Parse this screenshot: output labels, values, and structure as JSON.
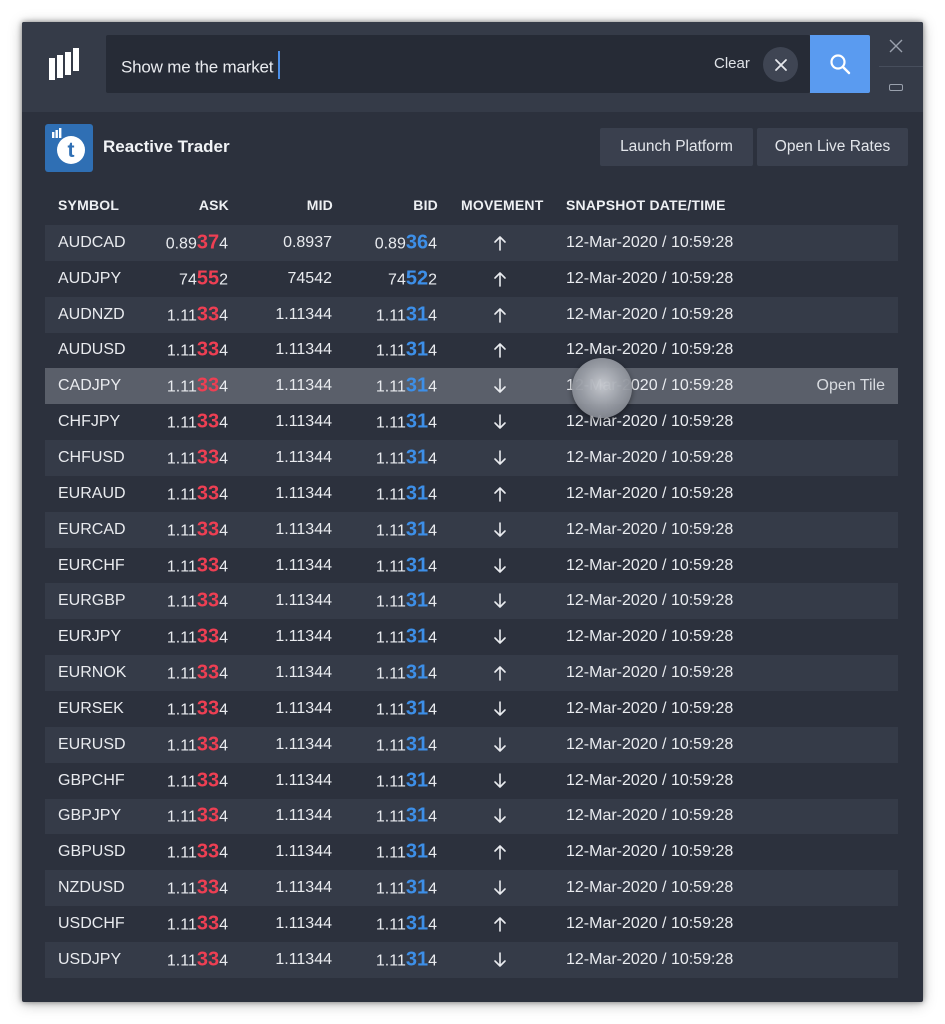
{
  "search": {
    "query": "Show me the market",
    "clear_label": "Clear",
    "search_icon": "search-icon",
    "clear_icon": "close-icon"
  },
  "window_controls": {
    "close_icon": "close-icon",
    "minimize_icon": "minimize-icon"
  },
  "app": {
    "name": "Reactive Trader",
    "icon": "t",
    "launch_label": "Launch Platform",
    "live_rates_label": "Open Live Rates"
  },
  "table": {
    "columns": [
      "SYMBOL",
      "ASK",
      "MID",
      "BID",
      "MOVEMENT",
      "SNAPSHOT DATE/TIME"
    ],
    "hover_action": "Open Tile",
    "rows": [
      {
        "symbol": "AUDCAD",
        "ask": [
          "0.89",
          "37",
          "4"
        ],
        "mid": "0.8937",
        "bid": [
          "0.89",
          "36",
          "4"
        ],
        "movement": "up",
        "datetime": "12-Mar-2020 / 10:59:28"
      },
      {
        "symbol": "AUDJPY",
        "ask": [
          "74",
          "55",
          "2"
        ],
        "mid": "74542",
        "bid": [
          "74",
          "52",
          "2"
        ],
        "movement": "up",
        "datetime": "12-Mar-2020 / 10:59:28"
      },
      {
        "symbol": "AUDNZD",
        "ask": [
          "1.11",
          "33",
          "4"
        ],
        "mid": "1.11344",
        "bid": [
          "1.11",
          "31",
          "4"
        ],
        "movement": "up",
        "datetime": "12-Mar-2020 / 10:59:28"
      },
      {
        "symbol": "AUDUSD",
        "ask": [
          "1.11",
          "33",
          "4"
        ],
        "mid": "1.11344",
        "bid": [
          "1.11",
          "31",
          "4"
        ],
        "movement": "up",
        "datetime": "12-Mar-2020 / 10:59:28"
      },
      {
        "symbol": "CADJPY",
        "ask": [
          "1.11",
          "33",
          "4"
        ],
        "mid": "1.11344",
        "bid": [
          "1.11",
          "31",
          "4"
        ],
        "movement": "down",
        "datetime": "12-Mar-2020 / 10:59:28",
        "hover": true
      },
      {
        "symbol": "CHFJPY",
        "ask": [
          "1.11",
          "33",
          "4"
        ],
        "mid": "1.11344",
        "bid": [
          "1.11",
          "31",
          "4"
        ],
        "movement": "down",
        "datetime": "12-Mar-2020 / 10:59:28"
      },
      {
        "symbol": "CHFUSD",
        "ask": [
          "1.11",
          "33",
          "4"
        ],
        "mid": "1.11344",
        "bid": [
          "1.11",
          "31",
          "4"
        ],
        "movement": "down",
        "datetime": "12-Mar-2020 / 10:59:28"
      },
      {
        "symbol": "EURAUD",
        "ask": [
          "1.11",
          "33",
          "4"
        ],
        "mid": "1.11344",
        "bid": [
          "1.11",
          "31",
          "4"
        ],
        "movement": "up",
        "datetime": "12-Mar-2020 / 10:59:28"
      },
      {
        "symbol": "EURCAD",
        "ask": [
          "1.11",
          "33",
          "4"
        ],
        "mid": "1.11344",
        "bid": [
          "1.11",
          "31",
          "4"
        ],
        "movement": "down",
        "datetime": "12-Mar-2020 / 10:59:28"
      },
      {
        "symbol": "EURCHF",
        "ask": [
          "1.11",
          "33",
          "4"
        ],
        "mid": "1.11344",
        "bid": [
          "1.11",
          "31",
          "4"
        ],
        "movement": "down",
        "datetime": "12-Mar-2020 / 10:59:28"
      },
      {
        "symbol": "EURGBP",
        "ask": [
          "1.11",
          "33",
          "4"
        ],
        "mid": "1.11344",
        "bid": [
          "1.11",
          "31",
          "4"
        ],
        "movement": "down",
        "datetime": "12-Mar-2020 / 10:59:28"
      },
      {
        "symbol": "EURJPY",
        "ask": [
          "1.11",
          "33",
          "4"
        ],
        "mid": "1.11344",
        "bid": [
          "1.11",
          "31",
          "4"
        ],
        "movement": "down",
        "datetime": "12-Mar-2020 / 10:59:28"
      },
      {
        "symbol": "EURNOK",
        "ask": [
          "1.11",
          "33",
          "4"
        ],
        "mid": "1.11344",
        "bid": [
          "1.11",
          "31",
          "4"
        ],
        "movement": "up",
        "datetime": "12-Mar-2020 / 10:59:28"
      },
      {
        "symbol": "EURSEK",
        "ask": [
          "1.11",
          "33",
          "4"
        ],
        "mid": "1.11344",
        "bid": [
          "1.11",
          "31",
          "4"
        ],
        "movement": "down",
        "datetime": "12-Mar-2020 / 10:59:28"
      },
      {
        "symbol": "EURUSD",
        "ask": [
          "1.11",
          "33",
          "4"
        ],
        "mid": "1.11344",
        "bid": [
          "1.11",
          "31",
          "4"
        ],
        "movement": "down",
        "datetime": "12-Mar-2020 / 10:59:28"
      },
      {
        "symbol": "GBPCHF",
        "ask": [
          "1.11",
          "33",
          "4"
        ],
        "mid": "1.11344",
        "bid": [
          "1.11",
          "31",
          "4"
        ],
        "movement": "down",
        "datetime": "12-Mar-2020 / 10:59:28"
      },
      {
        "symbol": "GBPJPY",
        "ask": [
          "1.11",
          "33",
          "4"
        ],
        "mid": "1.11344",
        "bid": [
          "1.11",
          "31",
          "4"
        ],
        "movement": "down",
        "datetime": "12-Mar-2020 / 10:59:28"
      },
      {
        "symbol": "GBPUSD",
        "ask": [
          "1.11",
          "33",
          "4"
        ],
        "mid": "1.11344",
        "bid": [
          "1.11",
          "31",
          "4"
        ],
        "movement": "up",
        "datetime": "12-Mar-2020 / 10:59:28"
      },
      {
        "symbol": "NZDUSD",
        "ask": [
          "1.11",
          "33",
          "4"
        ],
        "mid": "1.11344",
        "bid": [
          "1.11",
          "31",
          "4"
        ],
        "movement": "down",
        "datetime": "12-Mar-2020 / 10:59:28"
      },
      {
        "symbol": "USDCHF",
        "ask": [
          "1.11",
          "33",
          "4"
        ],
        "mid": "1.11344",
        "bid": [
          "1.11",
          "31",
          "4"
        ],
        "movement": "up",
        "datetime": "12-Mar-2020 / 10:59:28"
      },
      {
        "symbol": "USDJPY",
        "ask": [
          "1.11",
          "33",
          "4"
        ],
        "mid": "1.11344",
        "bid": [
          "1.11",
          "31",
          "4"
        ],
        "movement": "down",
        "datetime": "12-Mar-2020 / 10:59:28"
      }
    ]
  },
  "colors": {
    "ask_pips": "#ee3f53",
    "bid_pips": "#3d8fe8",
    "accent": "#5a9bf0",
    "background": "#2c313d"
  }
}
